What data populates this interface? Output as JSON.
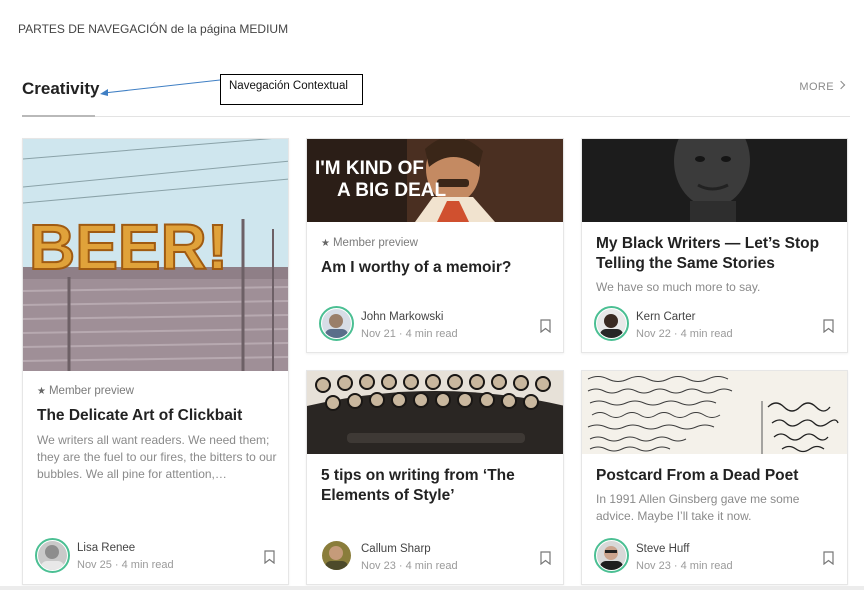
{
  "caption": "PARTES DE NAVEGACIÓN de la página MEDIUM",
  "section": {
    "title": "Creativity",
    "more_label": "MORE"
  },
  "annotation": {
    "label": "Navegación Contextual"
  },
  "cards": [
    {
      "image": "beer-sign",
      "image_text": "BEER!",
      "member_label": "Member preview",
      "title": "The Delicate Art of Clickbait",
      "subtitle": "We writers all want readers. We need them; they are the fuel to our fires, the bitters to our bubbles. We all pine for attention,…",
      "author": "Lisa Renee",
      "meta": "Nov 25 · 4 min read"
    },
    {
      "image": "anchorman-still",
      "image_text": "I'M KIND OF A BIG DEAL",
      "member_label": "Member preview",
      "title": "Am I worthy of a memoir?",
      "author": "John Markowski",
      "meta": "Nov 21 · 4 min read"
    },
    {
      "image": "portrait-dark",
      "title": "My Black Writers — Let’s Stop Telling the Same Stories",
      "subtitle": "We have so much more to say.",
      "author": "Kern Carter",
      "meta": "Nov 22 · 4 min read"
    },
    {
      "image": "typewriter-keys",
      "title": "5 tips on writing from ‘The Elements of Style’",
      "author": "Callum Sharp",
      "meta": "Nov 23 · 4 min read"
    },
    {
      "image": "handwritten-postcard",
      "title": "Postcard From a Dead Poet",
      "subtitle": "In 1991 Allen Ginsberg gave me some advice. Maybe I’ll take it now.",
      "author": "Steve Huff",
      "meta": "Nov 23 · 4 min read"
    }
  ],
  "icons": {
    "star": "star-icon",
    "bookmark": "bookmark-icon",
    "chevron": "chevron-right-icon"
  },
  "colors": {
    "avatar_ring": "#4bbf93",
    "muted_text": "#8a8a8a"
  }
}
